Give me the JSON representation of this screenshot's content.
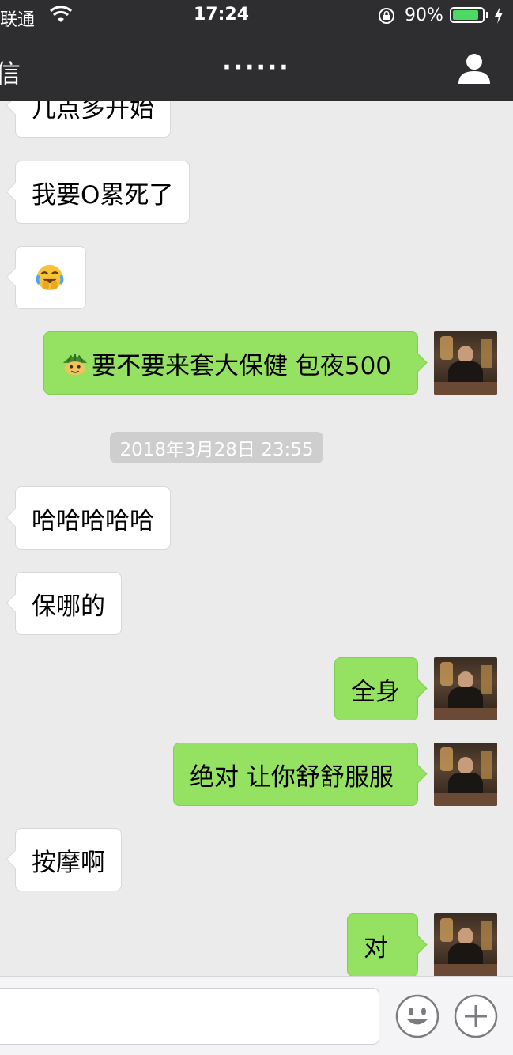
{
  "status_bar": {
    "carrier": "联通",
    "time": "17:24",
    "battery_percent": "90%",
    "battery_level": 0.9,
    "battery_color": "#4cd964"
  },
  "nav": {
    "back_label": "信",
    "title": "······"
  },
  "messages": [
    {
      "side": "left",
      "text": "几点多开始"
    },
    {
      "side": "left",
      "text": "我要O累死了"
    },
    {
      "side": "left",
      "text": "",
      "emoji": "crying-laughing-face-icon"
    },
    {
      "side": "right",
      "text": "要不要来套大保健 包夜500",
      "emoji": "turtle-face-icon"
    },
    {
      "side": "left",
      "text": "哈哈哈哈哈"
    },
    {
      "side": "left",
      "text": "保哪的"
    },
    {
      "side": "right",
      "text": "全身"
    },
    {
      "side": "right",
      "text": "绝对 让你舒舒服服"
    },
    {
      "side": "left",
      "text": "按摩啊"
    },
    {
      "side": "right",
      "text": "对"
    }
  ],
  "timestamp": "2018年3月28日 23:55",
  "colors": {
    "bubble_sent": "#95e162",
    "bubble_received": "#ffffff",
    "background": "#ebebeb",
    "header": "#2e2e30"
  }
}
